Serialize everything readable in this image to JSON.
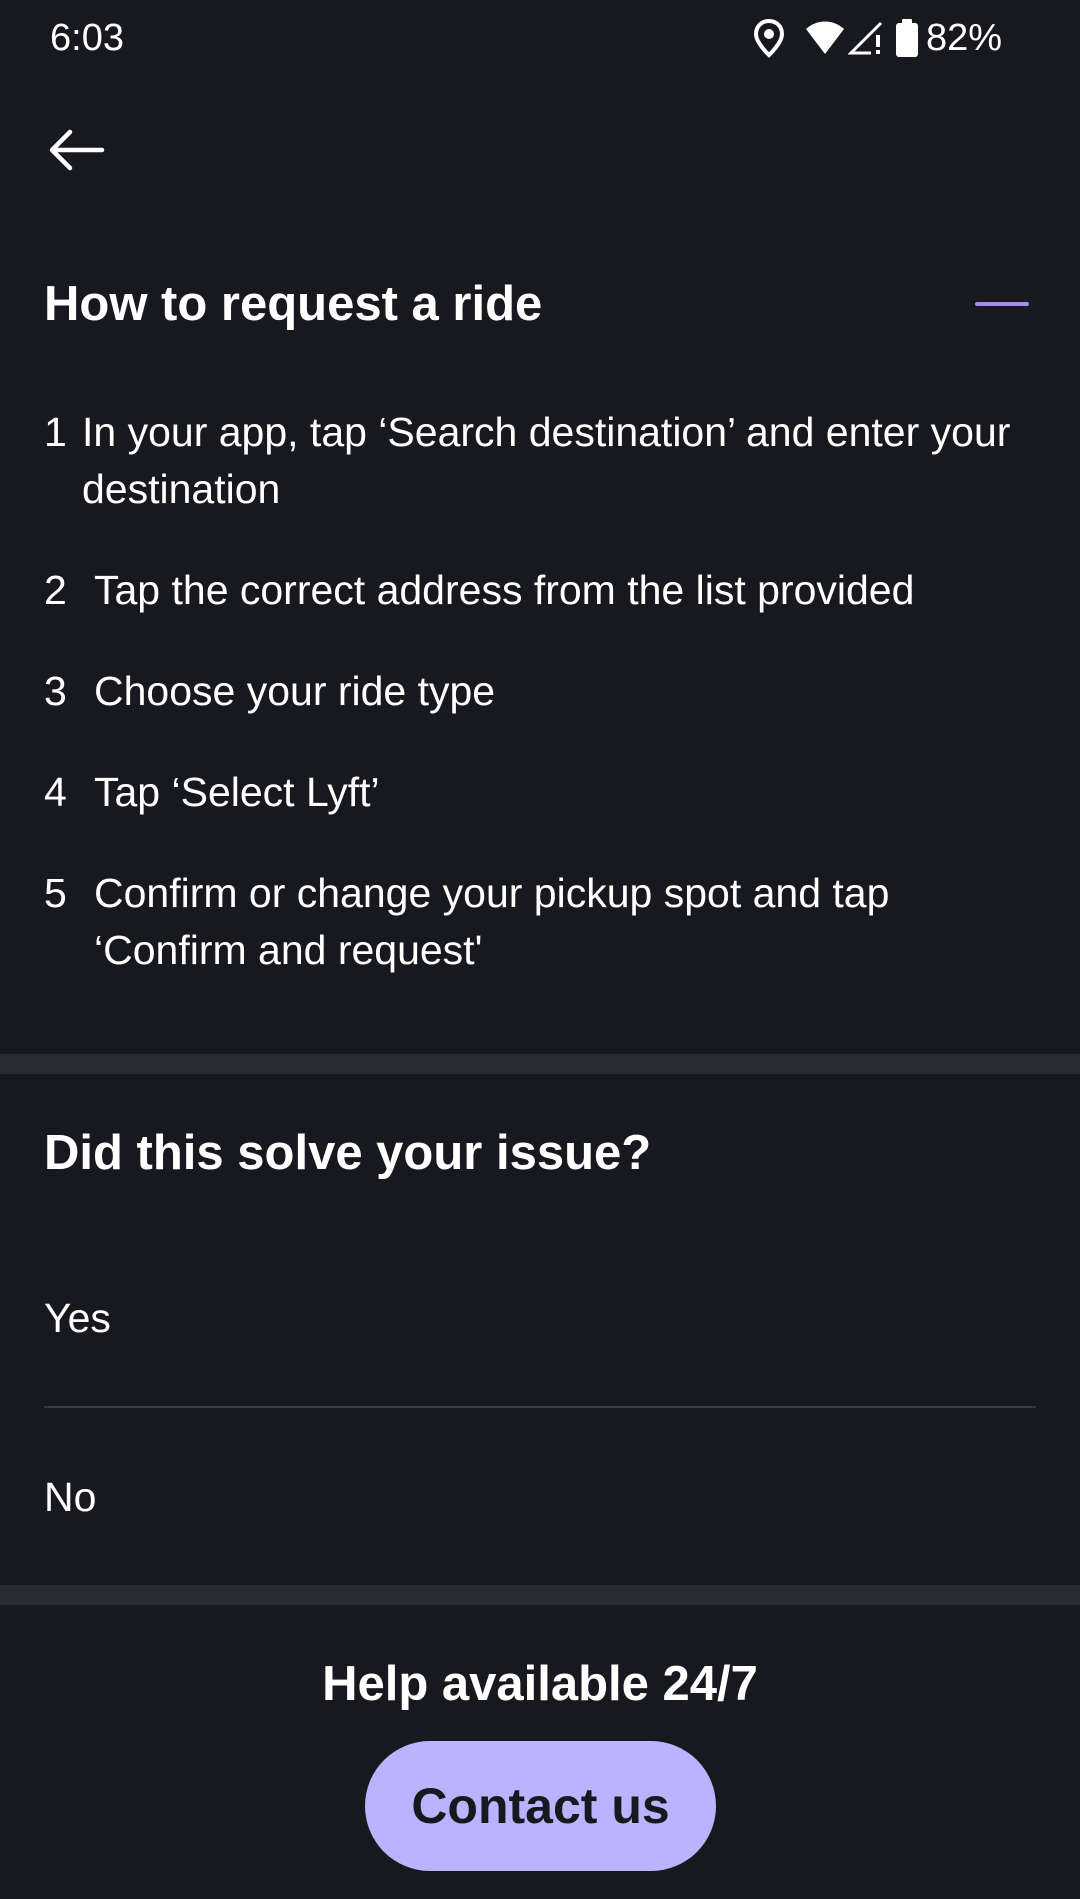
{
  "status_bar": {
    "time": "6:03",
    "battery_percent": "82%",
    "icons": [
      "location-icon",
      "wifi-icon",
      "signal-icon",
      "battery-icon"
    ]
  },
  "header": {
    "back_icon": "arrow-left-icon"
  },
  "article": {
    "title": "How to request a ride",
    "toggle_icon": "minus-icon",
    "toggle_color": "#a98bf0",
    "steps": [
      {
        "number": "1",
        "text": "In your app, tap ‘Search destination’ and enter your destination"
      },
      {
        "number": "2",
        "text": "Tap the correct address from the list provided"
      },
      {
        "number": "3",
        "text": "Choose your ride type"
      },
      {
        "number": "4",
        "text": "Tap ‘Select Lyft’"
      },
      {
        "number": "5",
        "text": "Confirm or change your pickup spot and tap ‘Confirm and request'"
      }
    ]
  },
  "feedback": {
    "title": "Did this solve your issue?",
    "options": [
      {
        "label": "Yes"
      },
      {
        "label": "No"
      }
    ]
  },
  "help": {
    "title": "Help available 24/7",
    "contact_label": "Contact us",
    "button_color": "#bdb2fd"
  },
  "colors": {
    "background": "#18191f",
    "divider": "#2a2b31",
    "text": "#ffffff"
  }
}
